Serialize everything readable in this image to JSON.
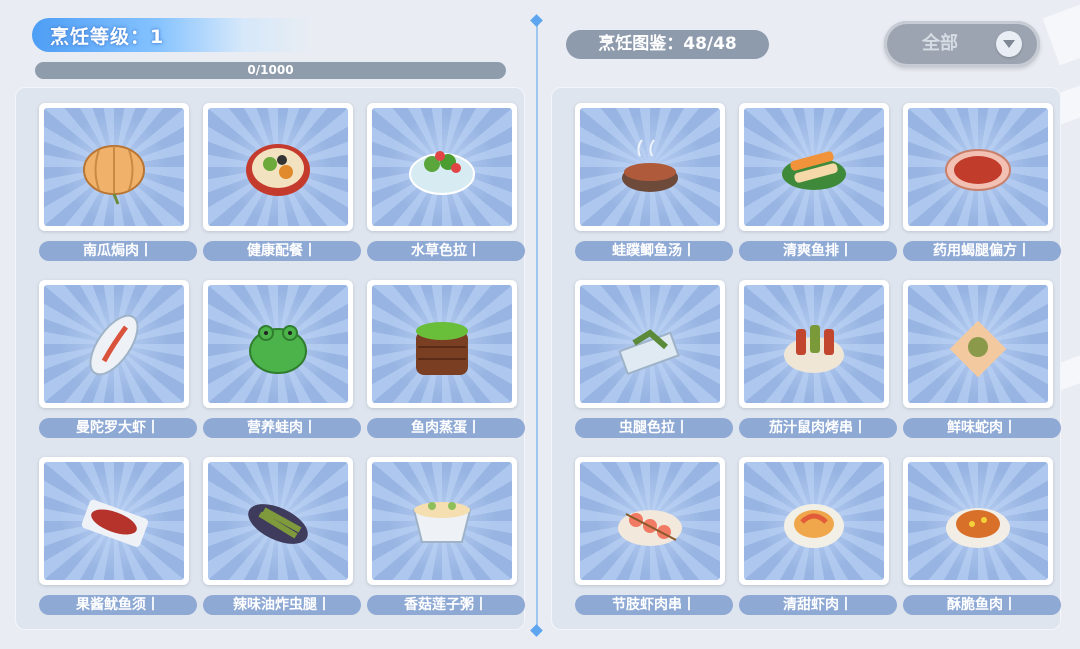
{
  "cooking": {
    "level_label": "烹饪等级：",
    "level_value": "1",
    "exp_text": "0/1000",
    "exp_progress": 0
  },
  "codex": {
    "title": "烹饪图鉴：48/48"
  },
  "filter": {
    "selected": "全部"
  },
  "left_recipes": [
    {
      "name": "南瓜焗肉丨",
      "icon": "pumpkin-dish-icon"
    },
    {
      "name": "健康配餐丨",
      "icon": "healthy-meal-icon"
    },
    {
      "name": "水草色拉丨",
      "icon": "seaweed-salad-icon"
    },
    {
      "name": "曼陀罗大虾丨",
      "icon": "datura-prawn-icon"
    },
    {
      "name": "营养蛙肉丨",
      "icon": "frog-meat-icon"
    },
    {
      "name": "鱼肉蒸蛋丨",
      "icon": "steamed-egg-icon"
    },
    {
      "name": "果酱鱿鱼须丨",
      "icon": "squid-icon"
    },
    {
      "name": "辣味油炸虫腿丨",
      "icon": "fried-bug-legs-icon"
    },
    {
      "name": "香菇莲子粥丨",
      "icon": "lotus-porridge-icon"
    }
  ],
  "right_recipes": [
    {
      "name": "蛙蹼鲫鱼汤丨",
      "icon": "fish-soup-icon"
    },
    {
      "name": "清爽鱼排丨",
      "icon": "fish-fillet-icon"
    },
    {
      "name": "药用蝎腿偏方丨",
      "icon": "scorpion-remedy-icon"
    },
    {
      "name": "虫腿色拉丨",
      "icon": "bug-leg-salad-icon"
    },
    {
      "name": "茄汁鼠肉烤串丨",
      "icon": "skewer-icon"
    },
    {
      "name": "鲜味蛇肉丨",
      "icon": "snake-meat-icon"
    },
    {
      "name": "节肢虾肉串丨",
      "icon": "shrimp-skewer-icon"
    },
    {
      "name": "清甜虾肉丨",
      "icon": "sweet-shrimp-icon"
    },
    {
      "name": "酥脆鱼肉丨",
      "icon": "crispy-fish-icon"
    }
  ]
}
